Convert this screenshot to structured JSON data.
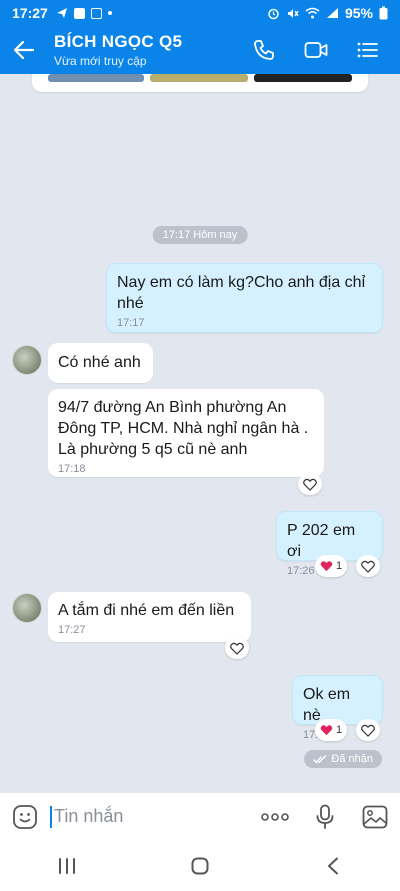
{
  "status_bar": {
    "time": "17:27",
    "battery": "95%"
  },
  "header": {
    "contact_name": "BÍCH NGỌC Q5",
    "presence": "Vừa mới truy cập"
  },
  "chat": {
    "time_separator": "17:17 Hôm nay",
    "messages": [
      {
        "direction": "out",
        "text": "Nay em có làm kg?Cho anh địa chỉ nhé",
        "time": "17:17"
      },
      {
        "direction": "in",
        "text": "Có nhé anh",
        "time": ""
      },
      {
        "direction": "in",
        "text": "94/7 đường An Bình phường An Đông TP, HCM. Nhà nghỉ ngân hà . Là phường 5 q5 cũ nè anh",
        "time": "17:18"
      },
      {
        "direction": "out",
        "text": "P 202 em ơi",
        "time": "17:26",
        "reaction_count": "1"
      },
      {
        "direction": "in",
        "text": "A tắm đi nhé em đến liền",
        "time": "17:27"
      },
      {
        "direction": "out",
        "text": "Ok em nè",
        "time": "17:27",
        "reaction_count": "1"
      }
    ],
    "delivery_status": "Đã nhận"
  },
  "composer": {
    "placeholder": "Tin nhắn"
  },
  "colors": {
    "brand": "#0a84e8",
    "outgoing_bubble": "#d5f1ff",
    "incoming_bubble": "#ffffff",
    "heart": "#e0245e"
  },
  "icons": [
    "back-arrow-icon",
    "phone-icon",
    "video-call-icon",
    "menu-icon",
    "heart-icon",
    "sticker-icon",
    "more-icon",
    "microphone-icon",
    "image-icon",
    "recents-icon",
    "home-icon",
    "back-nav-icon"
  ]
}
